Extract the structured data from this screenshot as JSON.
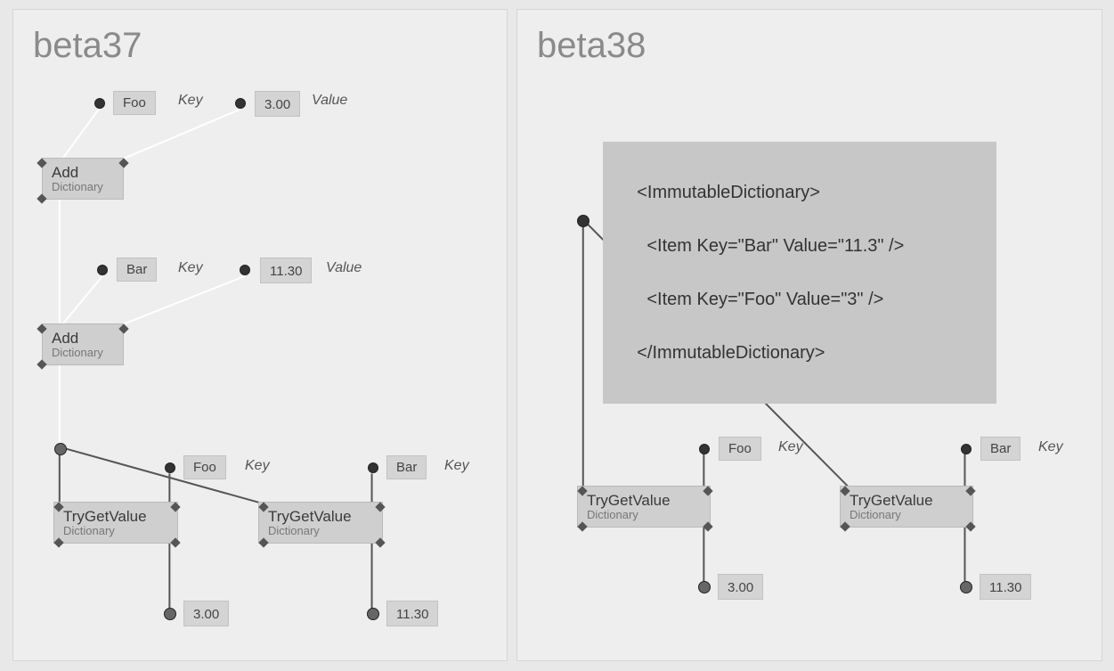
{
  "left": {
    "title": "beta37",
    "nodes": {
      "foo1": {
        "label": "Foo"
      },
      "foo1_key": "Key",
      "val1": {
        "label": "3.00"
      },
      "val1_label": "Value",
      "add1": {
        "title": "Add",
        "sub": "Dictionary"
      },
      "bar1": {
        "label": "Bar"
      },
      "bar1_key": "Key",
      "val2": {
        "label": "11.30"
      },
      "val2_label": "Value",
      "add2": {
        "title": "Add",
        "sub": "Dictionary"
      },
      "foo2": {
        "label": "Foo"
      },
      "foo2_key": "Key",
      "bar2": {
        "label": "Bar"
      },
      "bar2_key": "Key",
      "try1": {
        "title": "TryGetValue",
        "sub": "Dictionary"
      },
      "try2": {
        "title": "TryGetValue",
        "sub": "Dictionary"
      },
      "out1": {
        "label": "3.00"
      },
      "out2": {
        "label": "11.30"
      }
    }
  },
  "right": {
    "title": "beta38",
    "xml_lines": [
      "<ImmutableDictionary>",
      "  <Item Key=\"Bar\" Value=\"11.3\" />",
      "  <Item Key=\"Foo\" Value=\"3\" />",
      "</ImmutableDictionary>"
    ],
    "nodes": {
      "foo": {
        "label": "Foo"
      },
      "foo_key": "Key",
      "bar": {
        "label": "Bar"
      },
      "bar_key": "Key",
      "try1": {
        "title": "TryGetValue",
        "sub": "Dictionary"
      },
      "try2": {
        "title": "TryGetValue",
        "sub": "Dictionary"
      },
      "out1": {
        "label": "3.00"
      },
      "out2": {
        "label": "11.30"
      }
    }
  }
}
